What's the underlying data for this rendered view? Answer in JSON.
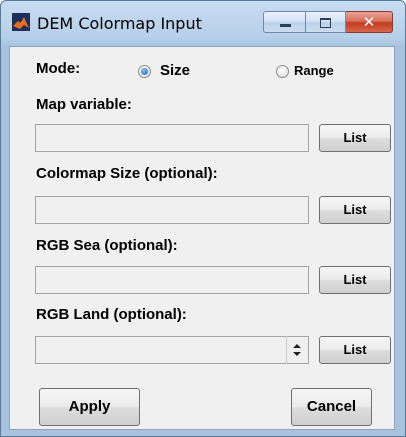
{
  "window": {
    "title": "DEM Colormap Input",
    "icon": "matlab-membrane-icon",
    "controls": [
      "minimize-icon",
      "maximize-icon",
      "close-icon"
    ],
    "close_glyph": "✕"
  },
  "mode": {
    "label": "Mode:",
    "options": [
      {
        "label": "Size",
        "selected": true
      },
      {
        "label": "Range",
        "selected": false
      }
    ]
  },
  "fields": [
    {
      "label": "Map variable:",
      "value": "",
      "button": "List"
    },
    {
      "label": "Colormap Size (optional):",
      "value": "",
      "button": "List"
    },
    {
      "label": "RGB Sea (optional):",
      "value": "",
      "button": "List"
    },
    {
      "label": "RGB Land (optional):",
      "value": "",
      "button": "List"
    }
  ],
  "actions": {
    "apply": "Apply",
    "cancel": "Cancel"
  },
  "colors": {
    "title_bar": "#b9d1ea",
    "client_bg": "#f0f0f0",
    "close_button": "#c43a1f",
    "radio_selected": "#1a5fb4"
  }
}
